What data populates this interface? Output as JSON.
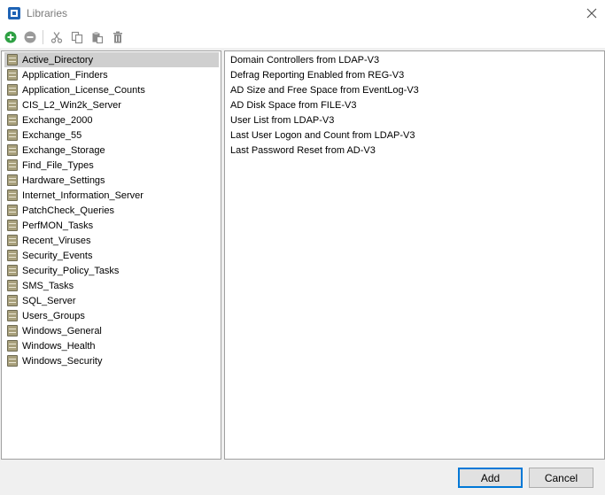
{
  "window": {
    "title": "Libraries",
    "icon": "app-logo-icon"
  },
  "toolbar": {
    "buttons": [
      {
        "name": "add-icon",
        "color": "#2ea043",
        "enabled": true
      },
      {
        "name": "remove-icon",
        "color": "#9a9a9a",
        "enabled": false
      },
      {
        "name": "cut-icon",
        "enabled": false
      },
      {
        "name": "copy-icon",
        "enabled": false
      },
      {
        "name": "paste-icon",
        "enabled": false
      },
      {
        "name": "delete-icon",
        "enabled": false
      }
    ]
  },
  "libraries": {
    "selected": "Active_Directory",
    "items": [
      "Active_Directory",
      "Application_Finders",
      "Application_License_Counts",
      "CIS_L2_Win2k_Server",
      "Exchange_2000",
      "Exchange_55",
      "Exchange_Storage",
      "Find_File_Types",
      "Hardware_Settings",
      "Internet_Information_Server",
      "PatchCheck_Queries",
      "PerfMON_Tasks",
      "Recent_Viruses",
      "Security_Events",
      "Security_Policy_Tasks",
      "SMS_Tasks",
      "SQL_Server",
      "Users_Groups",
      "Windows_General",
      "Windows_Health",
      "Windows_Security"
    ]
  },
  "queries": {
    "items": [
      "Domain Controllers from LDAP-V3",
      "Defrag Reporting Enabled from REG-V3",
      "AD Size and Free Space from EventLog-V3",
      "AD Disk Space from FILE-V3",
      "User List from LDAP-V3",
      "Last User Logon and Count from LDAP-V3",
      "Last Password Reset from AD-V3"
    ]
  },
  "footer": {
    "add_label": "Add",
    "cancel_label": "Cancel"
  }
}
